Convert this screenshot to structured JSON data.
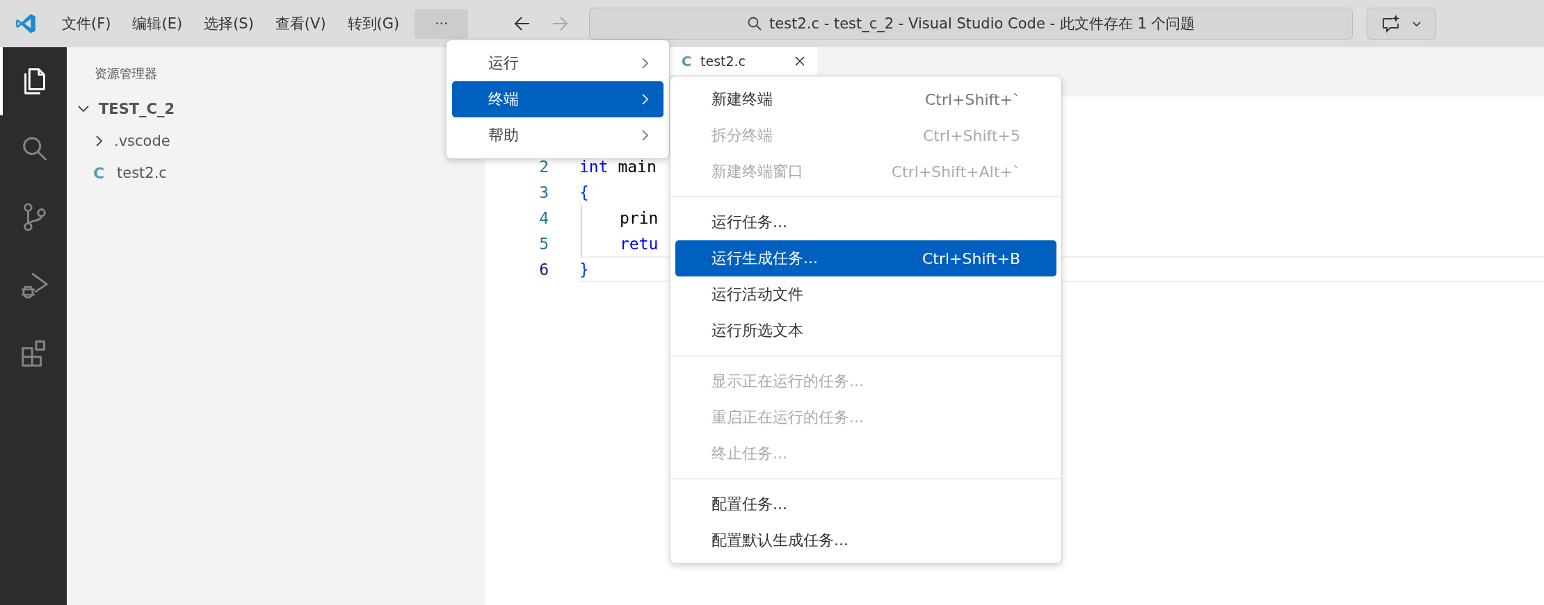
{
  "title_bar": {
    "menus": [
      {
        "label": "文件(F)"
      },
      {
        "label": "编辑(E)"
      },
      {
        "label": "选择(S)"
      },
      {
        "label": "查看(V)"
      },
      {
        "label": "转到(G)"
      }
    ],
    "more_label": "···",
    "nav_buttons": [
      {
        "kind": "back",
        "disabled": false
      },
      {
        "kind": "forward",
        "disabled": true
      }
    ],
    "command_center": "test2.c - test_c_2 - Visual Studio Code - 此文件存在 1 个问题"
  },
  "activity_bar": {
    "items": [
      {
        "kind": "explorer",
        "selected": true
      },
      {
        "kind": "search",
        "selected": false
      },
      {
        "kind": "source-control",
        "selected": false
      },
      {
        "kind": "run-debug",
        "selected": false
      },
      {
        "kind": "extensions",
        "selected": false
      }
    ]
  },
  "sidebar": {
    "title": "资源管理器",
    "tree": [
      {
        "label": "TEST_C_2",
        "kind": "folder",
        "expanded": true,
        "children": [
          {
            "label": ".vscode",
            "kind": "folder",
            "expanded": false
          },
          {
            "label": "test2.c",
            "kind": "file",
            "icon": "C"
          }
        ]
      }
    ]
  },
  "editor": {
    "tabs": [
      {
        "label": "test2.c",
        "icon": "C",
        "selected": true
      }
    ],
    "lines": [
      {
        "number": "2",
        "current": false,
        "indent": false,
        "tokens": [
          {
            "text": "int",
            "kind": "keyword"
          },
          {
            "text": " main",
            "kind": "plain"
          }
        ]
      },
      {
        "number": "3",
        "current": false,
        "indent": false,
        "tokens": [
          {
            "text": "{",
            "kind": "bracket"
          }
        ]
      },
      {
        "number": "4",
        "current": false,
        "indent": true,
        "tokens": [
          {
            "text": "prin",
            "kind": "plain"
          }
        ]
      },
      {
        "number": "5",
        "current": false,
        "indent": true,
        "tokens": [
          {
            "text": "retu",
            "kind": "keyword"
          }
        ]
      },
      {
        "number": "6",
        "current": true,
        "indent": false,
        "tokens": [
          {
            "text": "}",
            "kind": "bracket"
          }
        ]
      }
    ]
  },
  "menu": {
    "items": [
      {
        "label": "运行",
        "selected": false
      },
      {
        "label": "终端",
        "selected": true
      },
      {
        "label": "帮助",
        "selected": false
      }
    ]
  },
  "submenu": {
    "groups": [
      {
        "items": [
          {
            "label": "新建终端",
            "shortcut": "Ctrl+Shift+`",
            "disabled": false,
            "selected": false
          },
          {
            "label": "拆分终端",
            "shortcut": "Ctrl+Shift+5",
            "disabled": true,
            "selected": false
          },
          {
            "label": "新建终端窗口",
            "shortcut": "Ctrl+Shift+Alt+`",
            "disabled": true,
            "selected": false
          }
        ]
      },
      {
        "items": [
          {
            "label": "运行任务...",
            "disabled": false,
            "selected": false
          },
          {
            "label": "运行生成任务...",
            "shortcut": "Ctrl+Shift+B",
            "disabled": false,
            "selected": true
          },
          {
            "label": "运行活动文件",
            "disabled": false,
            "selected": false
          },
          {
            "label": "运行所选文本",
            "disabled": false,
            "selected": false
          }
        ]
      },
      {
        "items": [
          {
            "label": "显示正在运行的任务...",
            "disabled": true,
            "selected": false
          },
          {
            "label": "重启正在运行的任务...",
            "disabled": true,
            "selected": false
          },
          {
            "label": "终止任务...",
            "disabled": true,
            "selected": false
          }
        ]
      },
      {
        "items": [
          {
            "label": "配置任务...",
            "disabled": false,
            "selected": false
          },
          {
            "label": "配置默认生成任务...",
            "disabled": false,
            "selected": false
          }
        ]
      }
    ]
  }
}
